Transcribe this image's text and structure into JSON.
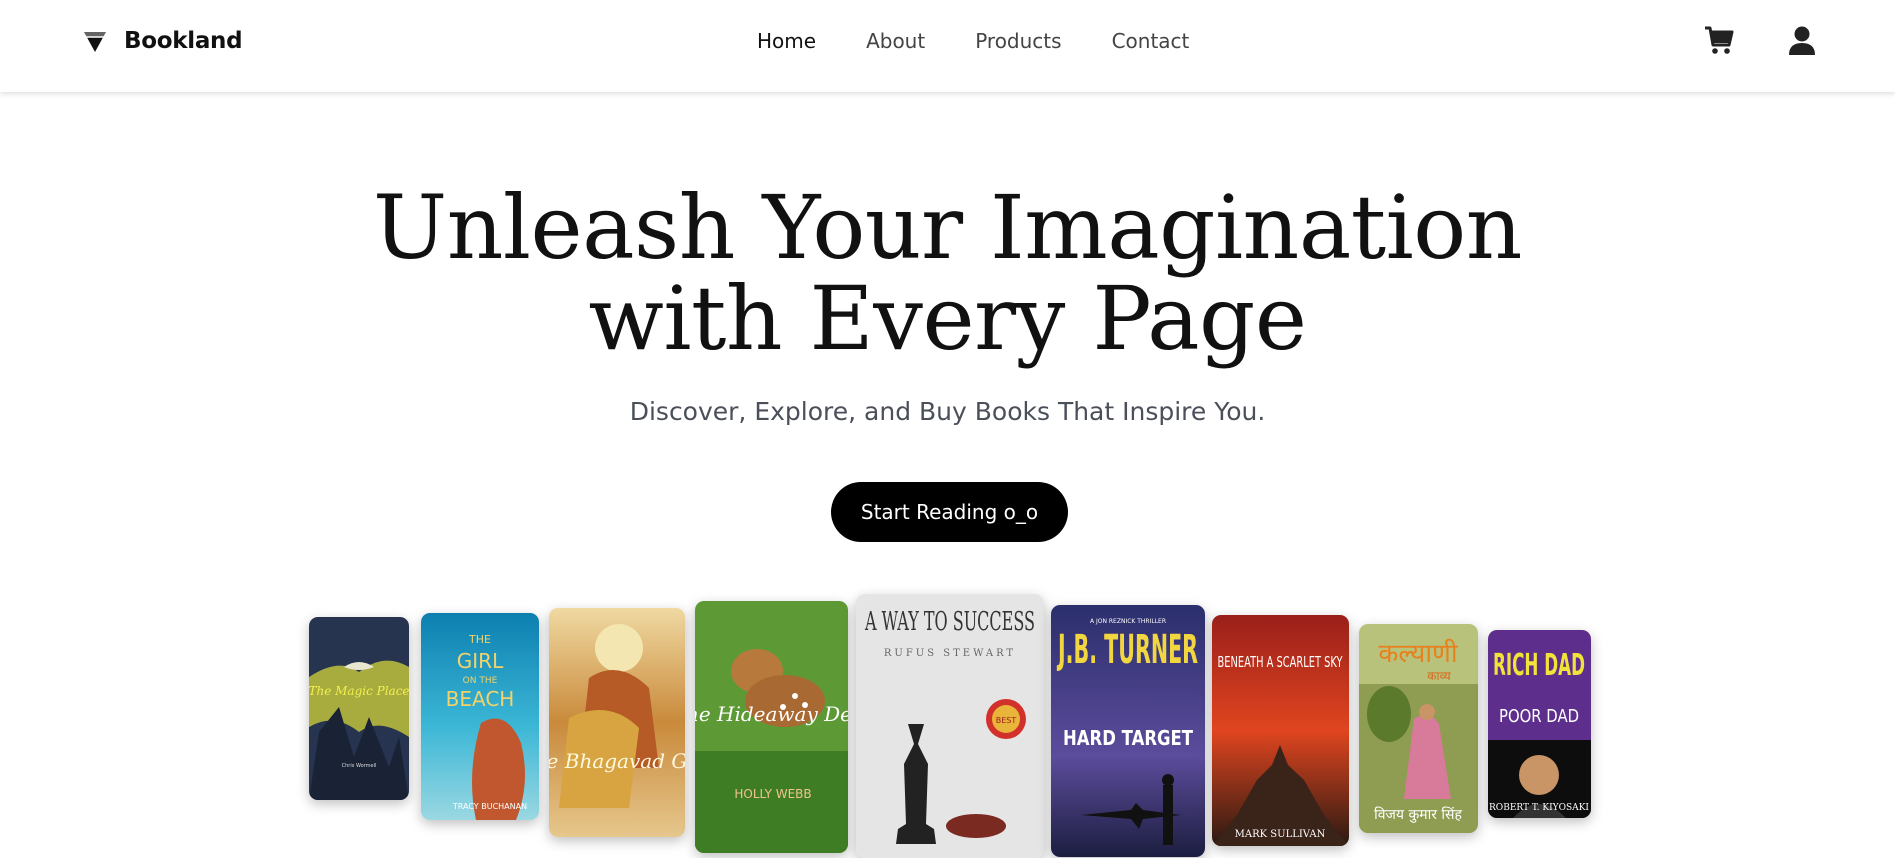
{
  "brand": {
    "name": "Bookland"
  },
  "nav": {
    "items": [
      "Home",
      "About",
      "Products",
      "Contact"
    ],
    "active": "Home"
  },
  "hero": {
    "title_line1": "Unleash Your Imagination",
    "title_line2": "with Every Page",
    "subtitle": "Discover, Explore, and Buy Books That Inspire You.",
    "cta_label": "Start Reading o_o"
  },
  "books": [
    {
      "title": "The Magic Place",
      "cover_text": "The Magic Place",
      "author": "Chris Wormell",
      "color": "#2a3a5a"
    },
    {
      "title": "The Girl on the Beach",
      "cover_text": "THE GIRL ON THE BEACH",
      "author": "TRACY BUCHANAN",
      "color": "#1f8db5"
    },
    {
      "title": "The Bhagavad Gita",
      "cover_text": "The Bhagavad Gita",
      "author": "",
      "color": "#c99a4a"
    },
    {
      "title": "The Hideaway Deer",
      "cover_text": "The Hideaway Deer",
      "author": "HOLLY WEBB",
      "color": "#4d8a2f"
    },
    {
      "title": "A Way to Success",
      "cover_text": "A WAY TO SUCCESS",
      "author": "RUFUS STEWART",
      "color": "#e2e2e2"
    },
    {
      "title": "Hard Target",
      "cover_text": "J.B. TURNER",
      "subtitle": "HARD TARGET",
      "series": "A JON REZNICK THRILLER",
      "color": "#2c2f6a"
    },
    {
      "title": "Beneath a Scarlet Sky",
      "cover_text": "BENEATH A SCARLET SKY",
      "author": "MARK SULLIVAN",
      "color": "#b72a1e"
    },
    {
      "title": "Kalyani",
      "cover_text": "कल्याणी",
      "subtitle": "काव्य",
      "author": "विजय कुमार सिंह",
      "color": "#a8b86a"
    },
    {
      "title": "Rich Dad Poor Dad",
      "cover_text": "RICH DAD",
      "subtitle": "POOR DAD",
      "author": "ROBERT T. KIYOSAKI",
      "color": "#5b2d8a"
    }
  ],
  "icons": {
    "logo": "diamond-logo-icon",
    "cart": "cart-icon",
    "user": "user-icon"
  }
}
